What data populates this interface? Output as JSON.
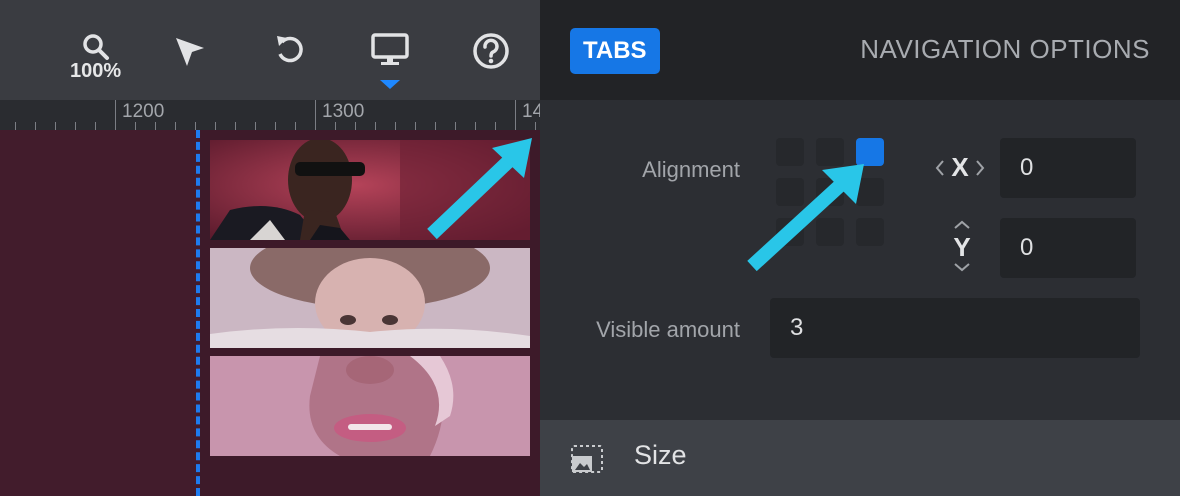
{
  "toolbar": {
    "zoom_label": "100%",
    "icons": [
      "search-icon",
      "pointer-icon",
      "undo-icon",
      "desktop-icon",
      "help-icon"
    ],
    "active_accent": "#1e88ff"
  },
  "ruler": {
    "labels": [
      "1200",
      "1300",
      "14"
    ]
  },
  "panel": {
    "tabs_label": "TABS",
    "title": "NAVIGATION OPTIONS",
    "alignment_label": "Alignment",
    "alignment_selected": "top-right",
    "x_label": "X",
    "x_value": "0",
    "y_label": "Y",
    "y_value": "0",
    "visible_amount_label": "Visible amount",
    "visible_amount_value": "3",
    "size_label": "Size"
  },
  "colors": {
    "accent": "#1677e6",
    "annotation_arrow": "#29c6e8"
  }
}
